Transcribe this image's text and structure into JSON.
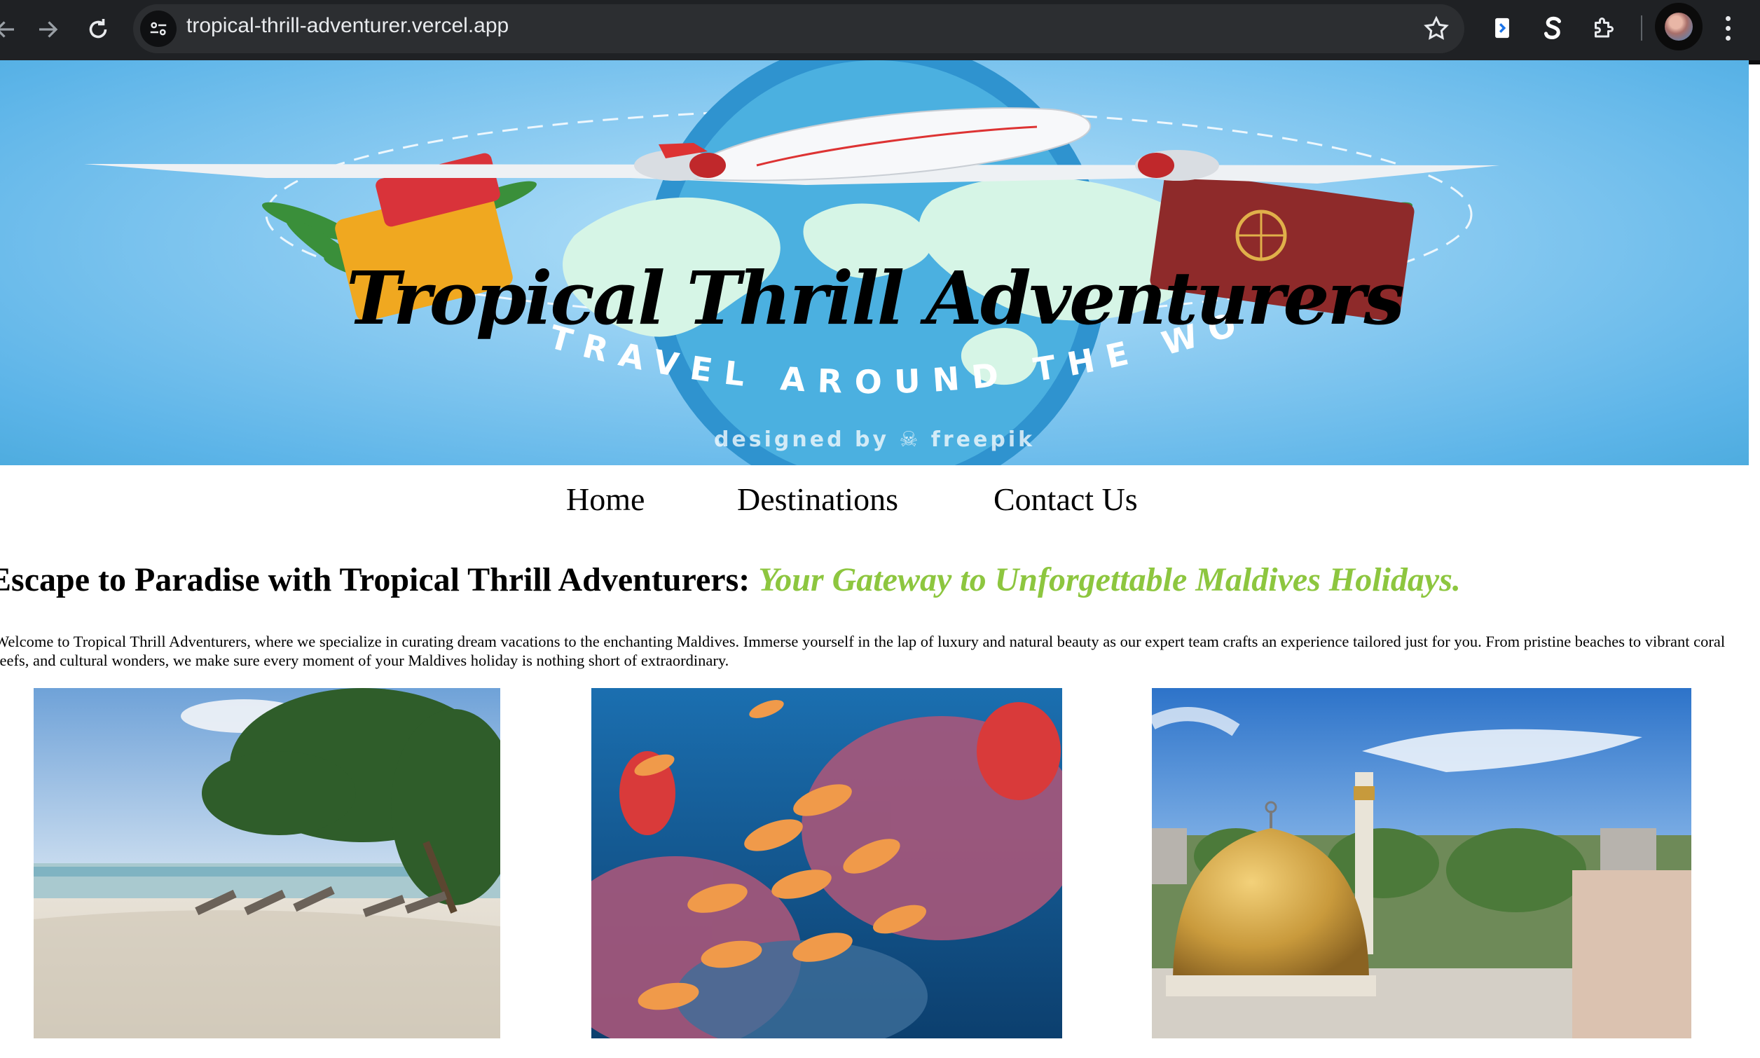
{
  "browser": {
    "url": "tropical-thrill-adventurer.vercel.app",
    "icons": [
      "back-icon",
      "forward-icon",
      "reload-icon",
      "site-info-icon",
      "bookmark-star-icon",
      "extension-doc-icon",
      "extension-s-icon",
      "extensions-puzzle-icon",
      "profile-avatar",
      "menu-kebab-icon"
    ]
  },
  "hero": {
    "title": "Tropical Thrill Adventurers",
    "arc_text": "TRAVEL AROUND THE WORLD",
    "credit": "designed by ☠ freepik"
  },
  "nav": {
    "items": [
      "Home",
      "Destinations",
      "Contact Us"
    ]
  },
  "main": {
    "headline_plain": "Escape to Paradise with Tropical Thrill Adventurers: ",
    "headline_accent": "Your Gateway to Unforgettable Maldives Holidays.",
    "intro": "Welcome to Tropical Thrill Adventurers, where we specialize in curating dream vacations to the enchanting Maldives. Immerse yourself in the lap of luxury and natural beauty as our expert team crafts an experience tailored just for you. From pristine beaches to vibrant coral reefs, and cultural wonders, we make sure every moment of your Maldives holiday is nothing short of extraordinary.",
    "photos": [
      "beach-photo",
      "coral-reef-photo",
      "mosque-photo"
    ]
  },
  "colors": {
    "accent_green": "#8dc63f",
    "chrome_bg": "#1f2124",
    "sky_blue": "#5cb4e8"
  }
}
